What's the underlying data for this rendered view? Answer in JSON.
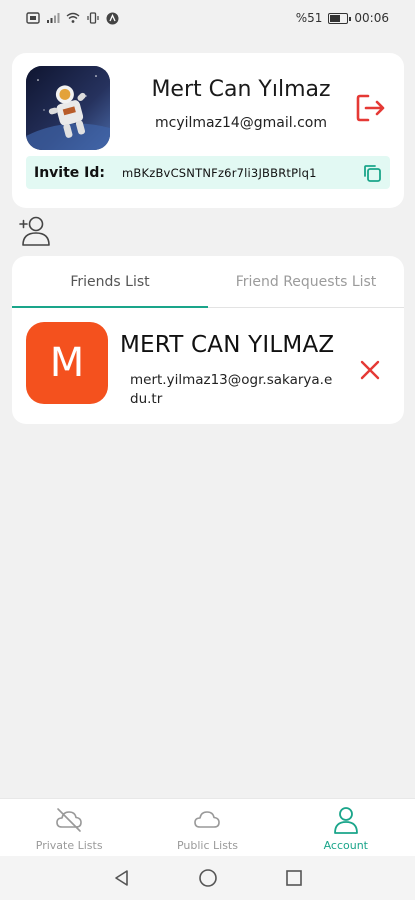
{
  "status_bar": {
    "battery": "%51",
    "time": "00:06",
    "battery_level": 0.51
  },
  "profile": {
    "name": "Mert Can Yılmaz",
    "email": "mcyilmaz14@gmail.com",
    "invite_label": "Invite Id:",
    "invite_id": "mBKzBvCSNTNFz6r7li3JBBRtPlq1"
  },
  "tabs": [
    {
      "label": "Friends List",
      "active": true
    },
    {
      "label": "Friend Requests List",
      "active": false
    }
  ],
  "friends": [
    {
      "initial": "M",
      "name": "MERT CAN YILMAZ",
      "email": "mert.yilmaz13@ogr.sakarya.edu.tr"
    }
  ],
  "bottom_nav": [
    {
      "label": "Private Lists",
      "icon": "cloud-off-icon",
      "active": false
    },
    {
      "label": "Public Lists",
      "icon": "cloud-icon",
      "active": false
    },
    {
      "label": "Account",
      "icon": "person-icon",
      "active": true
    }
  ],
  "colors": {
    "accent": "#1aa58a",
    "danger": "#e53935",
    "avatar": "#f4511e",
    "invite_bg": "#e2f9f3"
  }
}
